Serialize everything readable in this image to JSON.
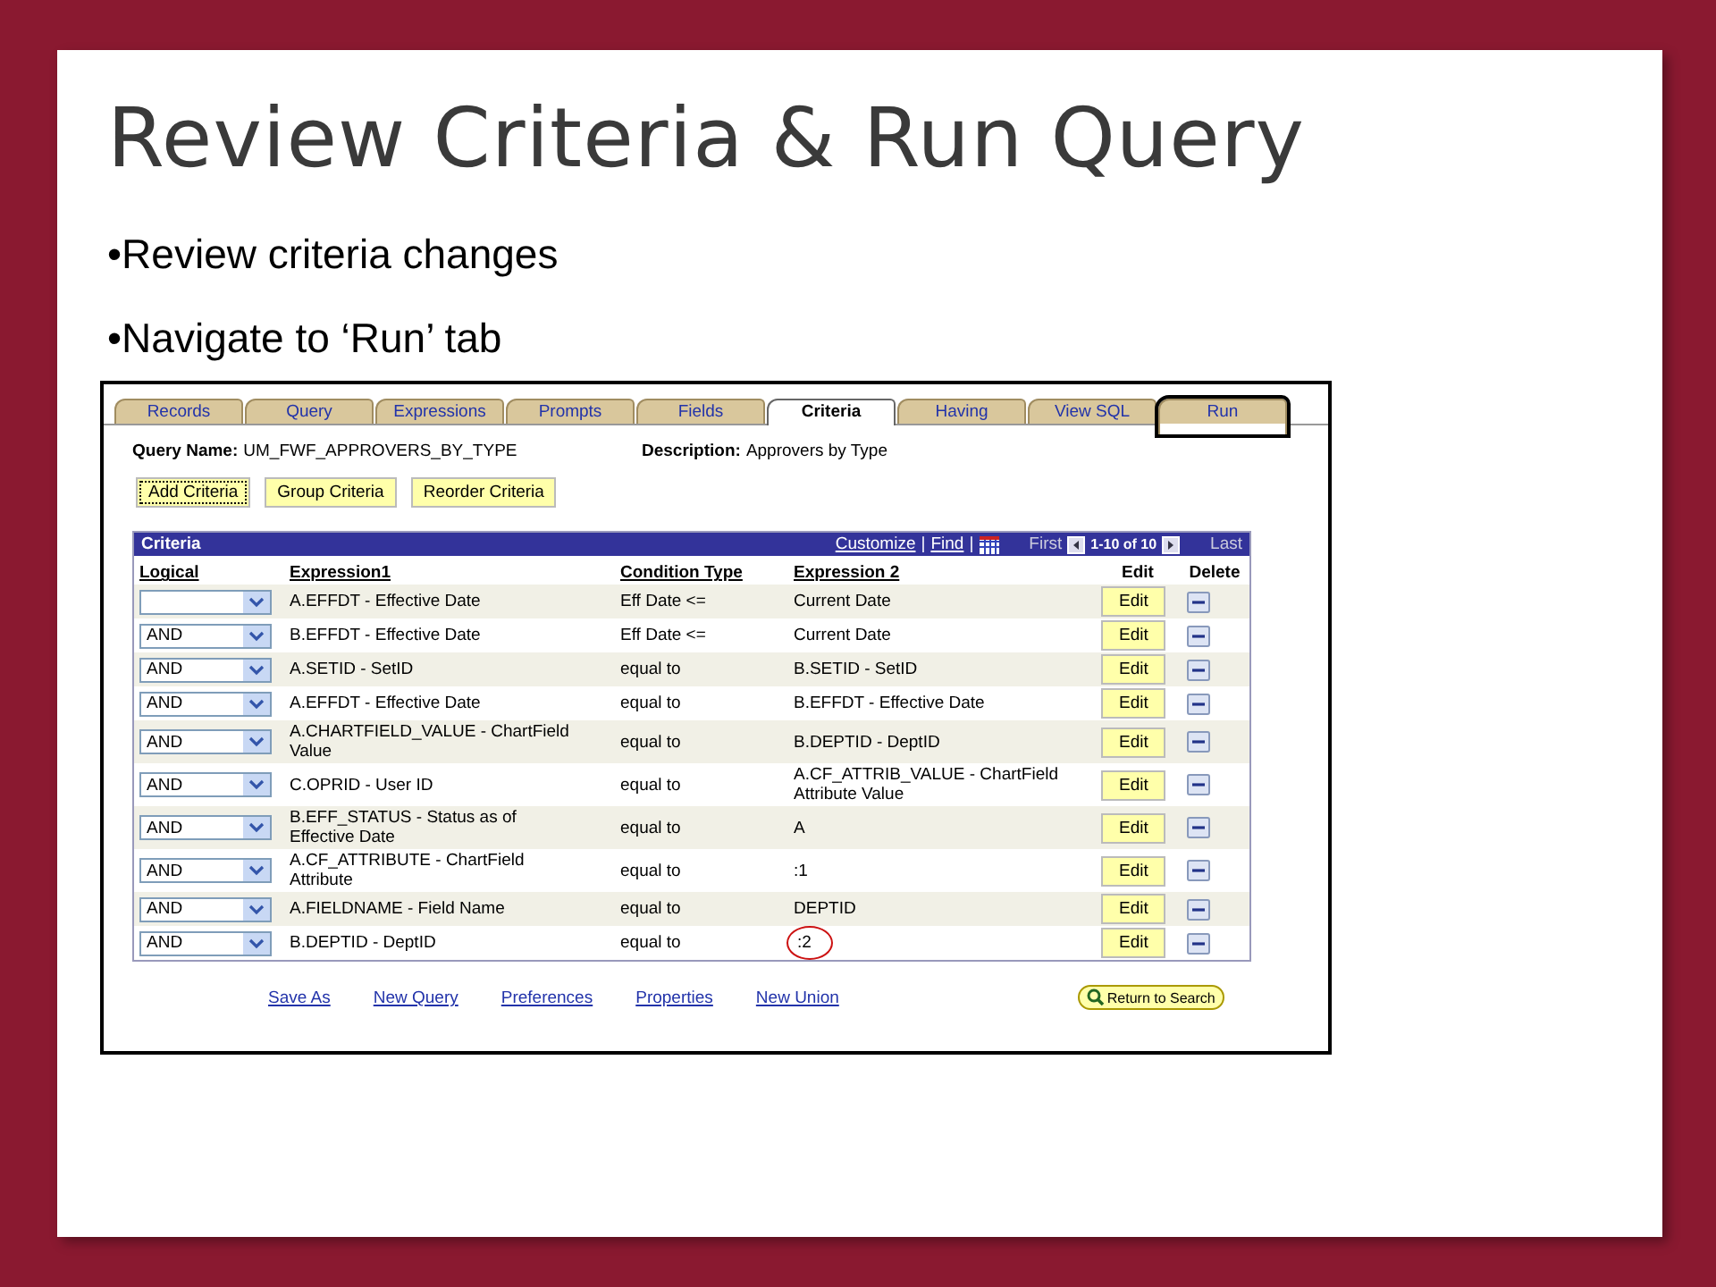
{
  "slide": {
    "title": "Review Criteria & Run Query",
    "bullets": [
      "•Review criteria changes",
      "•Navigate to ‘Run’ tab"
    ]
  },
  "tabs": [
    {
      "label": "Records",
      "selected": false,
      "highlighted": false
    },
    {
      "label": "Query",
      "selected": false,
      "highlighted": false
    },
    {
      "label": "Expressions",
      "selected": false,
      "highlighted": false
    },
    {
      "label": "Prompts",
      "selected": false,
      "highlighted": false
    },
    {
      "label": "Fields",
      "selected": false,
      "highlighted": false
    },
    {
      "label": "Criteria",
      "selected": true,
      "highlighted": false
    },
    {
      "label": "Having",
      "selected": false,
      "highlighted": false
    },
    {
      "label": "View SQL",
      "selected": false,
      "highlighted": false
    },
    {
      "label": "Run",
      "selected": false,
      "highlighted": true
    }
  ],
  "query_name": {
    "label": "Query Name:",
    "value": "UM_FWF_APPROVERS_BY_TYPE"
  },
  "description": {
    "label": "Description:",
    "value": "Approvers by Type"
  },
  "buttons": [
    {
      "label": "Add Criteria",
      "focused": true
    },
    {
      "label": "Group Criteria",
      "focused": false
    },
    {
      "label": "Reorder Criteria",
      "focused": false
    }
  ],
  "grid": {
    "title": "Criteria",
    "links": [
      "Customize",
      "Find"
    ],
    "separators": [
      "|",
      "|"
    ],
    "first": "First",
    "range": "1-10 of 10",
    "last": "Last",
    "columns": [
      "Logical",
      "Expression1",
      "Condition Type",
      "Expression 2",
      "Edit",
      "Delete"
    ],
    "rows": [
      {
        "expression1": "A.EFFDT - Effective Date",
        "condition": "Eff Date <=",
        "expression2": "Current Date",
        "edit": "Edit",
        "circled": false
      },
      {
        "logical": "AND",
        "expression1": "B.EFFDT - Effective Date",
        "condition": "Eff Date <=",
        "expression2": "Current Date",
        "edit": "Edit",
        "circled": false
      },
      {
        "logical": "AND",
        "expression1": "A.SETID - SetID",
        "condition": "equal to",
        "expression2": "B.SETID - SetID",
        "edit": "Edit",
        "circled": false
      },
      {
        "logical": "AND",
        "expression1": "A.EFFDT - Effective Date",
        "condition": "equal to",
        "expression2": "B.EFFDT - Effective Date",
        "edit": "Edit",
        "circled": false
      },
      {
        "logical": "AND",
        "expression1": "A.CHARTFIELD_VALUE - ChartField Value",
        "condition": "equal to",
        "expression2": "B.DEPTID - DeptID",
        "edit": "Edit",
        "circled": false
      },
      {
        "logical": "AND",
        "expression1": "C.OPRID - User ID",
        "condition": "equal to",
        "expression2": "A.CF_ATTRIB_VALUE - ChartField Attribute Value",
        "edit": "Edit",
        "circled": false
      },
      {
        "logical": "AND",
        "expression1": "B.EFF_STATUS - Status as of Effective Date",
        "condition": "equal to",
        "expression2": "A",
        "edit": "Edit",
        "circled": false
      },
      {
        "logical": "AND",
        "expression1": "A.CF_ATTRIBUTE - ChartField Attribute",
        "condition": "equal to",
        "expression2": ":1",
        "edit": "Edit",
        "circled": false
      },
      {
        "logical": "AND",
        "expression1": "A.FIELDNAME - Field Name",
        "condition": "equal to",
        "expression2": "DEPTID",
        "edit": "Edit",
        "circled": false
      },
      {
        "logical": "AND",
        "expression1": "B.DEPTID - DeptID",
        "condition": "equal to",
        "expression2": ":2",
        "edit": "Edit",
        "circled": true
      }
    ]
  },
  "footer_links": [
    "Save As",
    "New Query",
    "Preferences",
    "Properties",
    "New Union"
  ],
  "return_button": "Return to Search"
}
